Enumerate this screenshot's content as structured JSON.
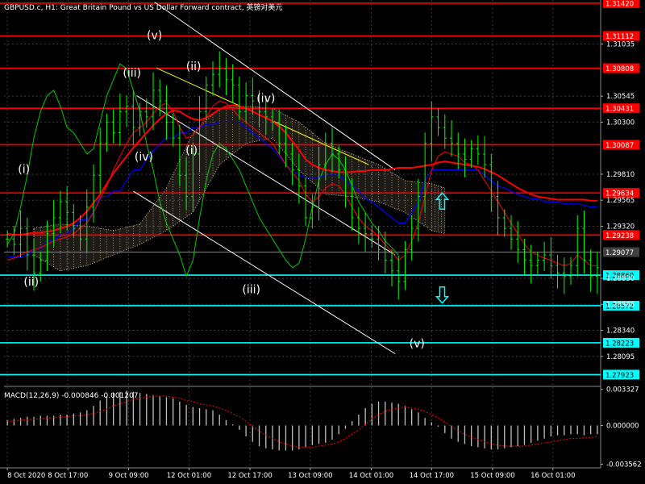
{
  "header": {
    "title": "GBPUSD.c, H1:  Great Britain Pound vs US Dollar Forward contract, 英镑对美元"
  },
  "colors": {
    "background": "#000000",
    "grid": "#3a3a3a",
    "candles": "#00ff00",
    "resistance": "#ff0000",
    "support": "#00ffff",
    "channel": "#ffffff",
    "trendline": "#ffff00",
    "cloud": "#f5deb3",
    "tenkan": "#ff0000",
    "kijun": "#0000ff",
    "chikou": "#00cc00",
    "ma": "#ff0000",
    "macd_hist": "#c0c0c0",
    "macd_signal": "#ff0000",
    "label_text": "#ffffff"
  },
  "chart_data": {
    "type": "candlestick",
    "symbol": "GBPUSD.c",
    "timeframe": "H1",
    "ylim": [
      1.2782,
      1.3145
    ],
    "y_ticks": [
      1.31035,
      1.30545,
      1.303,
      1.2981,
      1.29565,
      1.2932,
      1.2883,
      1.28585,
      1.2834,
      1.28095
    ],
    "x_labels": [
      "8 Oct 2020",
      "8 Oct 17:00",
      "9 Oct 09:00",
      "12 Oct 01:00",
      "12 Oct 17:00",
      "13 Oct 09:00",
      "14 Oct 01:00",
      "14 Oct 17:00",
      "15 Oct 09:00",
      "16 Oct 01:00"
    ],
    "x_label_pos": [
      0,
      9.14,
      18.3,
      27.4,
      36.6,
      45.7,
      54.9,
      64.0,
      73.2,
      82.3
    ],
    "n_bars": 90,
    "price_series": [
      1.292,
      1.2915,
      1.293,
      1.2905,
      1.2888,
      1.29,
      1.2925,
      1.294,
      1.2955,
      1.2945,
      1.293,
      1.292,
      1.295,
      1.298,
      1.301,
      1.303,
      1.302,
      1.304,
      1.3045,
      1.3025,
      1.304,
      1.3035,
      1.306,
      1.305,
      1.303,
      1.3015,
      1.298,
      1.296,
      1.3,
      1.304,
      1.3065,
      1.3075,
      1.308,
      1.307,
      1.3065,
      1.304,
      1.3055,
      1.305,
      1.304,
      1.3035,
      1.303,
      1.301,
      1.3,
      1.2985,
      1.297,
      1.294,
      1.295,
      1.299,
      1.301,
      1.3,
      1.2985,
      1.296,
      1.294,
      1.293,
      1.2925,
      1.292,
      1.291,
      1.29,
      1.289,
      1.288,
      1.291,
      1.293,
      1.296,
      1.301,
      1.3035,
      1.3025,
      1.3015,
      1.301,
      1.3,
      1.2995,
      1.3005,
      1.3,
      1.299,
      1.296,
      1.294,
      1.293,
      1.292,
      1.291,
      1.29,
      1.2895,
      1.29,
      1.2905,
      1.2895,
      1.2888,
      1.2885,
      1.2895,
      1.293,
      1.29,
      1.2885,
      1.2893
    ],
    "resistance_lines": [
      {
        "value": 1.3142,
        "label": "1.31420"
      },
      {
        "value": 1.31112,
        "label": "1.31112"
      },
      {
        "value": 1.30808,
        "label": "1.30808"
      },
      {
        "value": 1.30431,
        "label": "1.30431"
      },
      {
        "value": 1.30087,
        "label": "1.30087"
      },
      {
        "value": 1.29634,
        "label": "1.29634"
      },
      {
        "value": 1.29238,
        "label": "1.29238"
      }
    ],
    "support_lines": [
      {
        "value": 1.2886,
        "label": "1.28860"
      },
      {
        "value": 1.28572,
        "label": "1.28572"
      },
      {
        "value": 1.28223,
        "label": "1.28223"
      },
      {
        "value": 1.27923,
        "label": "1.27923"
      }
    ],
    "current_price": {
      "value": 1.29077,
      "label": "1.29077"
    },
    "wave_labels": [
      {
        "text": "(i)",
        "bar": 2.5,
        "price": 1.2982
      },
      {
        "text": "(ii)",
        "bar": 3.6,
        "price": 1.2876
      },
      {
        "text": "(iii)",
        "bar": 18.8,
        "price": 1.3073
      },
      {
        "text": "(iv)",
        "bar": 20.6,
        "price": 1.2994
      },
      {
        "text": "(v)",
        "bar": 22.2,
        "price": 1.3108
      },
      {
        "text": "(ii)",
        "bar": 28.1,
        "price": 1.3079
      },
      {
        "text": "(i)",
        "bar": 27.8,
        "price": 1.3
      },
      {
        "text": "(iii)",
        "bar": 36.8,
        "price": 1.2869
      },
      {
        "text": "(iv)",
        "bar": 39.0,
        "price": 1.3049
      },
      {
        "text": "(v)",
        "bar": 61.8,
        "price": 1.2818
      }
    ],
    "channel_lines": [
      {
        "from": [
          22.2,
          1.3143
        ],
        "to": [
          58.5,
          1.2985
        ]
      },
      {
        "from": [
          19.5,
          1.3055
        ],
        "to": [
          58.5,
          1.2905
        ]
      },
      {
        "from": [
          19.0,
          1.2965
        ],
        "to": [
          58.5,
          1.2812
        ]
      }
    ],
    "trend_lines": [
      {
        "from": [
          22.5,
          1.3081
        ],
        "to": [
          54.5,
          1.299
        ]
      }
    ],
    "ichimoku_cloud": {
      "x": [
        4,
        8,
        12,
        16,
        20,
        24,
        28,
        32,
        36,
        40,
        44,
        48,
        52,
        56,
        60,
        64,
        66
      ],
      "upper": [
        1.293,
        1.2934,
        1.2932,
        1.2928,
        1.2934,
        1.2968,
        1.302,
        1.3043,
        1.3045,
        1.3043,
        1.303,
        1.301,
        1.3,
        1.299,
        1.2975,
        1.2972,
        1.2968
      ],
      "lower": [
        1.2905,
        1.289,
        1.2895,
        1.2905,
        1.2915,
        1.2928,
        1.2945,
        1.299,
        1.301,
        1.3015,
        1.2985,
        1.2962,
        1.296,
        1.2955,
        1.2945,
        1.2928,
        1.2925
      ]
    },
    "tenkan_sen": [
      1.29,
      1.2902,
      1.2905,
      1.2908,
      1.291,
      1.2912,
      1.2915,
      1.2918,
      1.292,
      1.2922,
      1.2925,
      1.293,
      1.2935,
      1.2945,
      1.2958,
      1.297,
      1.2985,
      1.2998,
      1.301,
      1.302,
      1.3025,
      1.303,
      1.3038,
      1.3045,
      1.3048,
      1.304,
      1.3025,
      1.3015,
      1.3018,
      1.3025,
      1.3035,
      1.3045,
      1.305,
      1.3048,
      1.3042,
      1.3035,
      1.303,
      1.3025,
      1.302,
      1.3015,
      1.301,
      1.3,
      1.299,
      1.2982,
      1.2975,
      1.2962,
      1.2955,
      1.296,
      1.2968,
      1.2972,
      1.297,
      1.2962,
      1.295,
      1.294,
      1.2932,
      1.2928,
      1.2922,
      1.2915,
      1.2908,
      1.29,
      1.2905,
      1.2918,
      1.2935,
      1.296,
      1.2985,
      1.2998,
      1.3002,
      1.3,
      1.2998,
      1.2992,
      1.299,
      1.2985,
      1.2975,
      1.2965,
      1.2955,
      1.2945,
      1.2935,
      1.2925,
      1.2915,
      1.2908,
      1.2905,
      1.2902,
      1.29,
      1.2897,
      1.2895,
      1.2897,
      1.2905,
      1.29,
      1.2895,
      1.2895
    ],
    "kijun_sen": [
      1.2903,
      1.2903,
      1.2903,
      1.2905,
      1.291,
      1.291,
      1.2918,
      1.2918,
      1.2925,
      1.2925,
      1.293,
      1.2938,
      1.2938,
      1.2945,
      1.296,
      1.296,
      1.2965,
      1.2965,
      1.2975,
      1.2985,
      1.2985,
      1.2995,
      1.3003,
      1.301,
      1.3015,
      1.3015,
      1.302,
      1.302,
      1.3025,
      1.3025,
      1.3028,
      1.3028,
      1.303,
      1.303,
      1.303,
      1.303,
      1.3025,
      1.302,
      1.3015,
      1.301,
      1.3005,
      1.2998,
      1.299,
      1.2985,
      1.298,
      1.2978,
      1.2978,
      1.2978,
      1.298,
      1.298,
      1.298,
      1.2975,
      1.297,
      1.2965,
      1.2958,
      1.2955,
      1.295,
      1.2945,
      1.294,
      1.2935,
      1.2935,
      1.2945,
      1.2955,
      1.2975,
      1.2985,
      1.2985,
      1.2985,
      1.2985,
      1.2985,
      1.2985,
      1.2985,
      1.2985,
      1.298,
      1.2975,
      1.297,
      1.2968,
      1.2965,
      1.2962,
      1.296,
      1.2958,
      1.2958,
      1.2955,
      1.2955,
      1.2955,
      1.2953,
      1.2953,
      1.2953,
      1.2952,
      1.295,
      1.295
    ],
    "moving_average": [
      1.2925,
      1.2924,
      1.2924,
      1.2925,
      1.2926,
      1.2926,
      1.2927,
      1.2928,
      1.293,
      1.2932,
      1.2935,
      1.294,
      1.2946,
      1.2954,
      1.2962,
      1.2972,
      1.2982,
      1.299,
      1.2998,
      1.3006,
      1.3013,
      1.302,
      1.3027,
      1.3033,
      1.3038,
      1.3041,
      1.304,
      1.3036,
      1.3033,
      1.3032,
      1.3034,
      1.3038,
      1.3042,
      1.3045,
      1.3046,
      1.3045,
      1.3043,
      1.304,
      1.3037,
      1.3034,
      1.3031,
      1.3026,
      1.302,
      1.3012,
      1.3004,
      1.2995,
      1.299,
      1.2987,
      1.2985,
      1.2984,
      1.2983,
      1.2983,
      1.2983,
      1.2984,
      1.2984,
      1.2985,
      1.2985,
      1.2985,
      1.2986,
      1.2987,
      1.2987,
      1.2987,
      1.2988,
      1.2989,
      1.299,
      1.2992,
      1.2993,
      1.2992,
      1.2991,
      1.299,
      1.2989,
      1.2988,
      1.2986,
      1.2983,
      1.298,
      1.2976,
      1.2972,
      1.2968,
      1.2965,
      1.2962,
      1.296,
      1.2959,
      1.2958,
      1.2957,
      1.2957,
      1.2957,
      1.2957,
      1.2957,
      1.2956,
      1.2956
    ],
    "chikou_span": [
      1.2915,
      1.2925,
      1.295,
      1.298,
      1.3015,
      1.304,
      1.3055,
      1.306,
      1.3045,
      1.3025,
      1.302,
      1.301,
      1.3,
      1.3005,
      1.303,
      1.3055,
      1.307,
      1.3085,
      1.308,
      1.306,
      1.304,
      1.301,
      1.2985,
      1.2955,
      1.2935,
      1.292,
      1.2905,
      1.2885,
      1.29,
      1.294,
      1.2975,
      1.3,
      1.301,
      1.3005,
      1.2995,
      1.2985,
      1.297,
      1.2955,
      1.294,
      1.293,
      1.292,
      1.291,
      1.29,
      1.2893,
      1.2897,
      1.292,
      1.295,
      1.2975,
      1.299,
      1.3,
      1.2995,
      1.2985,
      1.297,
      1.2955,
      1.2945,
      1.2935,
      1.2928,
      1.2918,
      1.2912,
      1.2905
    ],
    "arrows": [
      {
        "direction": "up",
        "bar": 65.6,
        "price": 1.2955
      },
      {
        "direction": "down",
        "bar": 65.6,
        "price": 1.2868
      }
    ],
    "macd": {
      "title": "MACD(12,26,9) -0.000846 -0.001207",
      "ylim": [
        -0.0039,
        0.0036
      ],
      "y_ticks": [
        {
          "value": 0.003327,
          "label": "0.003327"
        },
        {
          "value": 0.0,
          "label": "0.000000"
        },
        {
          "value": -0.003562,
          "label": "-0.003562"
        }
      ],
      "histogram": [
        0.0005,
        0.0006,
        0.0007,
        0.0008,
        0.0008,
        0.0009,
        0.0009,
        0.0009,
        0.001,
        0.001,
        0.0011,
        0.0012,
        0.0014,
        0.0018,
        0.0023,
        0.0027,
        0.003,
        0.0031,
        0.0032,
        0.0031,
        0.003,
        0.0029,
        0.0028,
        0.0027,
        0.0026,
        0.0025,
        0.0022,
        0.0019,
        0.0017,
        0.0016,
        0.0015,
        0.0014,
        0.001,
        0.0005,
        0.0001,
        -0.0004,
        -0.001,
        -0.0015,
        -0.0019,
        -0.0021,
        -0.0022,
        -0.0023,
        -0.0023,
        -0.0023,
        -0.0022,
        -0.002,
        -0.0018,
        -0.0017,
        -0.0016,
        -0.0013,
        -0.0008,
        -0.0003,
        0.0004,
        0.001,
        0.0016,
        0.002,
        0.0022,
        0.0022,
        0.0021,
        0.002,
        0.0018,
        0.0015,
        0.0012,
        0.0007,
        0.0003,
        -0.0001,
        -0.0007,
        -0.0012,
        -0.0015,
        -0.0017,
        -0.0019,
        -0.002,
        -0.0021,
        -0.0022,
        -0.0022,
        -0.0021,
        -0.002,
        -0.0019,
        -0.0018,
        -0.0016,
        -0.0014,
        -0.0012,
        -0.001,
        -0.0009,
        -0.0009,
        -0.0008,
        -0.0008,
        -0.0009,
        -0.0008,
        -0.0008
      ],
      "signal": [
        0.0004,
        0.0004,
        0.0005,
        0.0005,
        0.0006,
        0.0006,
        0.0007,
        0.0007,
        0.0008,
        0.0008,
        0.0009,
        0.0009,
        0.001,
        0.0011,
        0.0013,
        0.0015,
        0.0018,
        0.002,
        0.0022,
        0.0024,
        0.0025,
        0.0026,
        0.0027,
        0.0027,
        0.0027,
        0.0026,
        0.0025,
        0.0023,
        0.0022,
        0.002,
        0.0019,
        0.0018,
        0.0016,
        0.0014,
        0.0011,
        0.0008,
        0.0004,
        -0.0001,
        -0.0005,
        -0.0009,
        -0.0012,
        -0.0015,
        -0.0017,
        -0.0019,
        -0.002,
        -0.002,
        -0.002,
        -0.0019,
        -0.0018,
        -0.0017,
        -0.0015,
        -0.0012,
        -0.0008,
        -0.0004,
        0.0001,
        0.0006,
        0.001,
        0.0013,
        0.0015,
        0.0016,
        0.0017,
        0.0016,
        0.0015,
        0.0013,
        0.001,
        0.0007,
        0.0003,
        -0.0001,
        -0.0005,
        -0.0008,
        -0.0011,
        -0.0013,
        -0.0015,
        -0.0017,
        -0.0018,
        -0.0019,
        -0.0019,
        -0.0019,
        -0.0019,
        -0.0018,
        -0.0017,
        -0.0016,
        -0.0015,
        -0.0014,
        -0.0013,
        -0.0012,
        -0.0012,
        -0.0011,
        -0.0011,
        -0.001
      ]
    }
  }
}
